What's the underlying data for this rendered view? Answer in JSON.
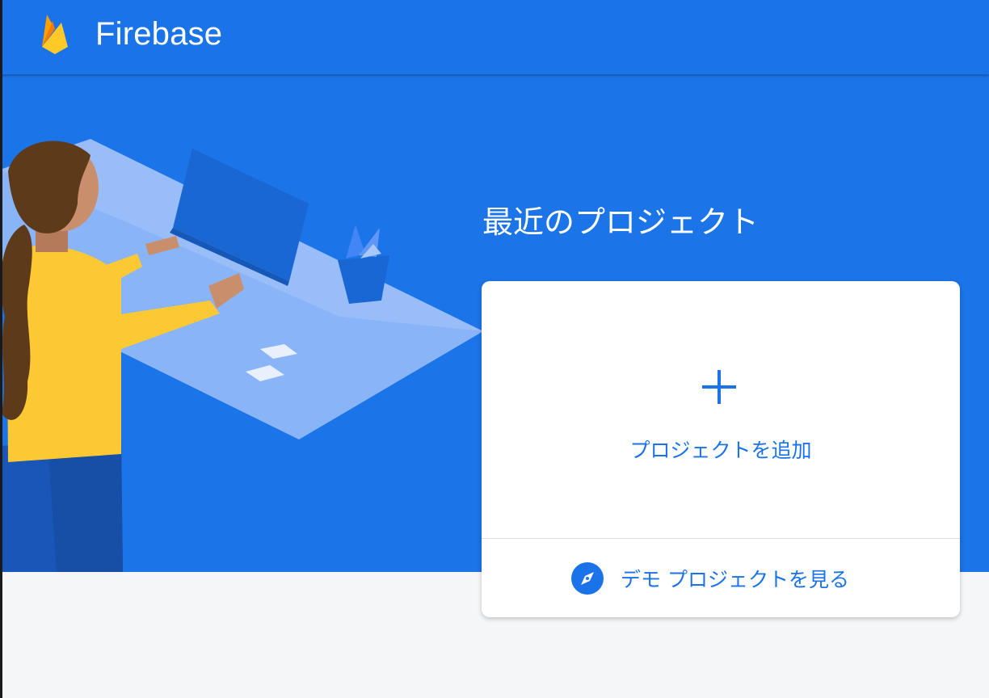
{
  "header": {
    "brand": "Firebase",
    "logo_icon": "firebase-flame-icon",
    "background": "#1a73e8"
  },
  "hero": {
    "background": "#1b74e8",
    "illustration": "woman-working-at-desk-illustration"
  },
  "recent_projects": {
    "title": "最近のプロジェクト",
    "add_project": {
      "icon": "plus-icon",
      "label": "プロジェクトを追加"
    },
    "demo_project": {
      "icon": "compass-icon",
      "label": "デモ プロジェクトを見る"
    }
  },
  "colors": {
    "accent": "#1a73e8",
    "page_background": "#f5f6f8",
    "flame_yellow": "#ffca28",
    "flame_orange": "#ffa000"
  }
}
